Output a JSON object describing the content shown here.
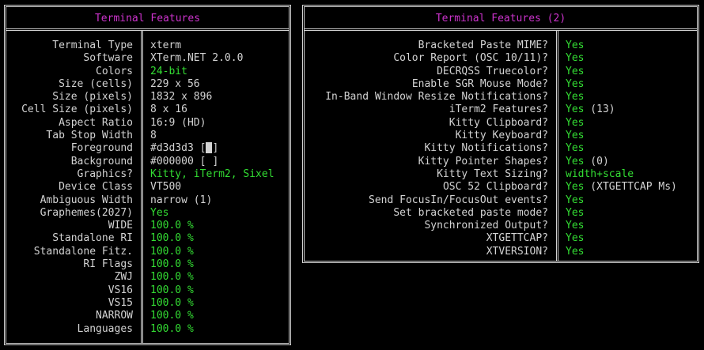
{
  "left_panel": {
    "title": "Terminal Features",
    "rows": [
      {
        "label": "Terminal Type",
        "value": "xterm",
        "style": "normal"
      },
      {
        "label": "Software",
        "value": "XTerm.NET 2.0.0",
        "style": "normal"
      },
      {
        "label": "Colors",
        "value": "24-bit",
        "style": "green"
      },
      {
        "label": "Size (cells)",
        "value": "229 x 56",
        "style": "normal"
      },
      {
        "label": "Size (pixels)",
        "value": "1832 x 896",
        "style": "normal"
      },
      {
        "label": "Cell Size (pixels)",
        "value": "8 x 16",
        "style": "normal"
      },
      {
        "label": "Aspect Ratio",
        "value": "16:9 (HD)",
        "style": "normal"
      },
      {
        "label": "Tab Stop Width",
        "value": "8",
        "style": "normal"
      },
      {
        "label": "Foreground",
        "value": "#d3d3d3 ",
        "style": "normal"
      },
      {
        "label": "Background",
        "value": "#000000 ",
        "style": "normal"
      },
      {
        "label": "Graphics?",
        "value": "Kitty, iTerm2, Sixel",
        "style": "green"
      },
      {
        "label": "Device Class",
        "value": "VT500",
        "style": "normal"
      },
      {
        "label": "Ambiguous Width",
        "value": "narrow (1)",
        "style": "normal"
      },
      {
        "label": "Graphemes(2027)",
        "value": "Yes",
        "style": "green"
      },
      {
        "label": "WIDE",
        "value": "100.0 %",
        "style": "green"
      },
      {
        "label": "Standalone RI",
        "value": "100.0 %",
        "style": "green"
      },
      {
        "label": "Standalone Fitz.",
        "value": "100.0 %",
        "style": "green"
      },
      {
        "label": "RI Flags",
        "value": "100.0 %",
        "style": "green"
      },
      {
        "label": "ZWJ",
        "value": "100.0 %",
        "style": "green"
      },
      {
        "label": "VS16",
        "value": "100.0 %",
        "style": "green"
      },
      {
        "label": "VS15",
        "value": "100.0 %",
        "style": "green"
      },
      {
        "label": "NARROW",
        "value": "100.0 %",
        "style": "green"
      },
      {
        "label": "Languages",
        "value": "100.0 %",
        "style": "green"
      }
    ],
    "foreground_swatch": "#d3d3d3",
    "background_swatch": "#000000"
  },
  "right_panel": {
    "title": "Terminal Features (2)",
    "rows": [
      {
        "label": "Bracketed Paste MIME?",
        "value": "Yes",
        "extra": ""
      },
      {
        "label": "Color Report (OSC 10/11)?",
        "value": "Yes",
        "extra": ""
      },
      {
        "label": "DECRQSS Truecolor?",
        "value": "Yes",
        "extra": ""
      },
      {
        "label": "Enable SGR Mouse Mode?",
        "value": "Yes",
        "extra": ""
      },
      {
        "label": "In-Band Window Resize Notifications?",
        "value": "Yes",
        "extra": ""
      },
      {
        "label": "iTerm2 Features?",
        "value": "Yes",
        "extra": " (13)"
      },
      {
        "label": "Kitty Clipboard?",
        "value": "Yes",
        "extra": ""
      },
      {
        "label": "Kitty Keyboard?",
        "value": "Yes",
        "extra": ""
      },
      {
        "label": "Kitty Notifications?",
        "value": "Yes",
        "extra": ""
      },
      {
        "label": "Kitty Pointer Shapes?",
        "value": "Yes",
        "extra": " (0)"
      },
      {
        "label": "Kitty Text Sizing?",
        "value": "width+scale",
        "extra": ""
      },
      {
        "label": "OSC 52 Clipboard?",
        "value": "Yes",
        "extra": " (XTGETTCAP Ms)"
      },
      {
        "label": "Send FocusIn/FocusOut events?",
        "value": "Yes",
        "extra": ""
      },
      {
        "label": "Set bracketed paste mode?",
        "value": "Yes",
        "extra": ""
      },
      {
        "label": "Synchronized Output?",
        "value": "Yes",
        "extra": ""
      },
      {
        "label": "XTGETTCAP?",
        "value": "Yes",
        "extra": ""
      },
      {
        "label": "XTVERSION?",
        "value": "Yes",
        "extra": ""
      }
    ]
  },
  "colors": {
    "title": "#cc33cc",
    "green": "#33dd33",
    "text": "#d3d3d3",
    "background": "#000000"
  }
}
